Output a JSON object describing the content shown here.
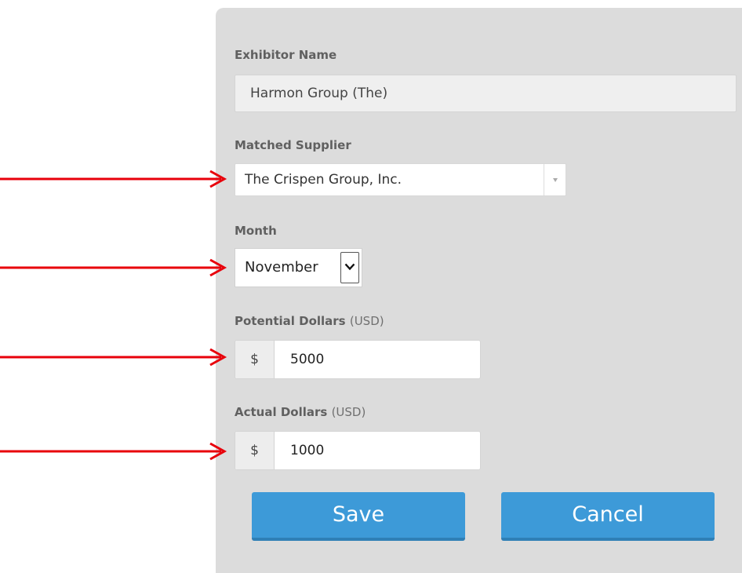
{
  "form": {
    "exhibitor_name": {
      "label": "Exhibitor Name",
      "value": "Harmon Group (The)"
    },
    "matched_supplier": {
      "label": "Matched Supplier",
      "value": "The Crispen Group, Inc."
    },
    "month": {
      "label": "Month",
      "value": "November"
    },
    "potential_dollars": {
      "label": "Potential Dollars",
      "unit": "(USD)",
      "currency_symbol": "$",
      "value": "5000"
    },
    "actual_dollars": {
      "label": "Actual Dollars",
      "unit": "(USD)",
      "currency_symbol": "$",
      "value": "1000"
    }
  },
  "buttons": {
    "save_label": "Save",
    "cancel_label": "Cancel"
  },
  "colors": {
    "panel_bg": "#dcdcdc",
    "button_blue": "#3d9ad8",
    "annotation_arrow": "#e8000b"
  }
}
